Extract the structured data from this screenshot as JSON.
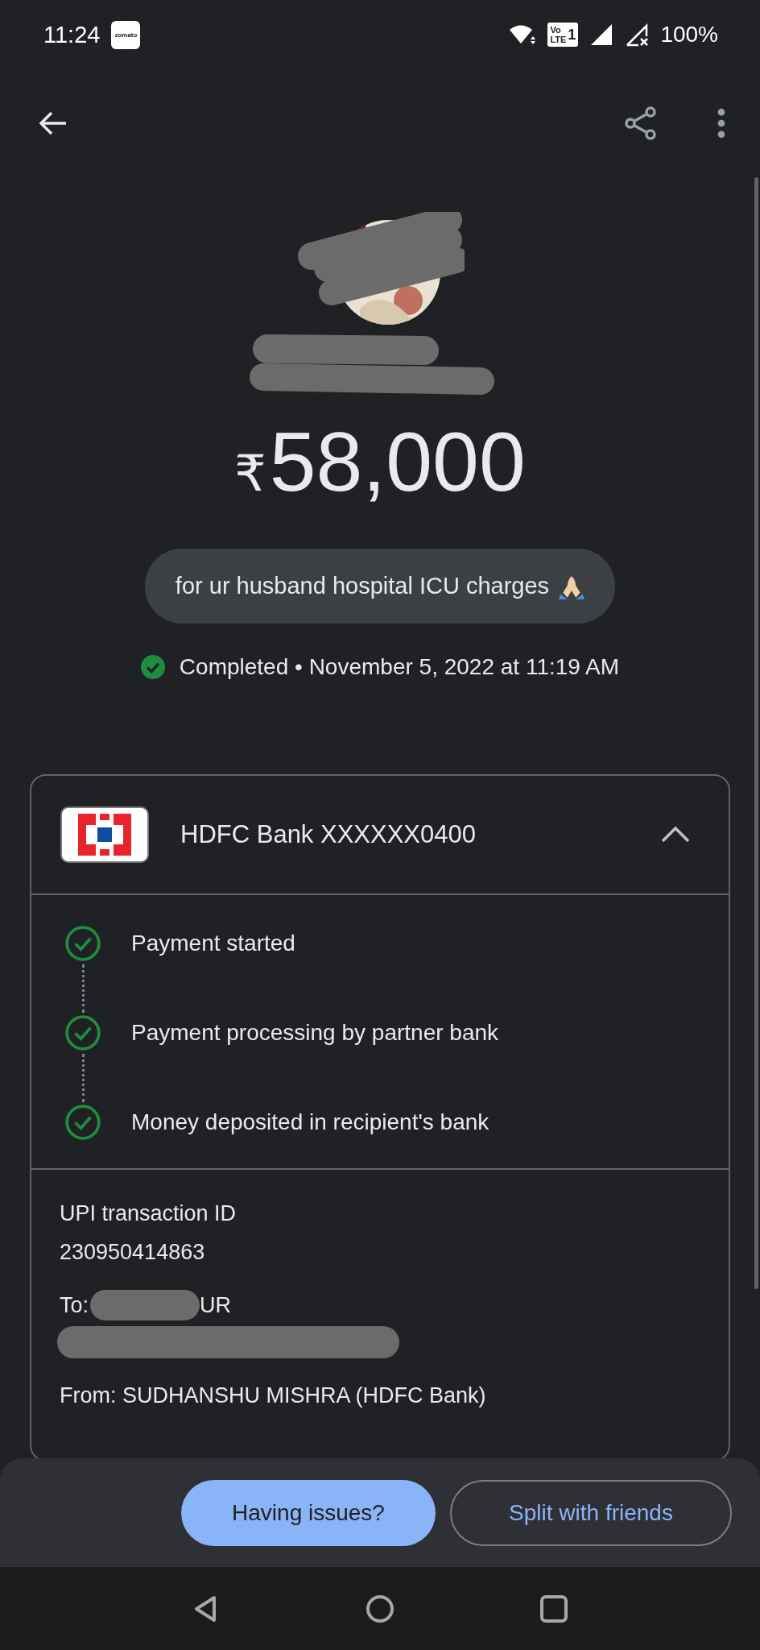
{
  "status_bar": {
    "time": "11:24",
    "notification_app": "zomato",
    "network": {
      "top": "Vo",
      "bottom": "LTE",
      "sim": "1"
    },
    "battery": "100%"
  },
  "amount": {
    "currency": "₹",
    "value": "58,000"
  },
  "note": "for ur husband hospital ICU charges",
  "status": {
    "kind": "completed",
    "label": "Completed",
    "separator": "•",
    "detail": "November 5, 2022 at 11:19 AM"
  },
  "account": {
    "bank": "HDFC Bank XXXXXX0400",
    "expanded": true
  },
  "steps": [
    {
      "label": "Payment started",
      "done": true
    },
    {
      "label": "Payment processing by partner bank",
      "done": true
    },
    {
      "label": "Money deposited in recipient's bank",
      "done": true
    }
  ],
  "details": {
    "id_label": "UPI transaction ID",
    "id": "230950414863",
    "to_prefix": "To:",
    "to_suffix": "UR",
    "from": "From: SUDHANSHU MISHRA (HDFC Bank)"
  },
  "buttons": [
    {
      "label": "Having issues?",
      "kind": "filled"
    },
    {
      "label": "Split with friends",
      "kind": "outlined"
    }
  ]
}
